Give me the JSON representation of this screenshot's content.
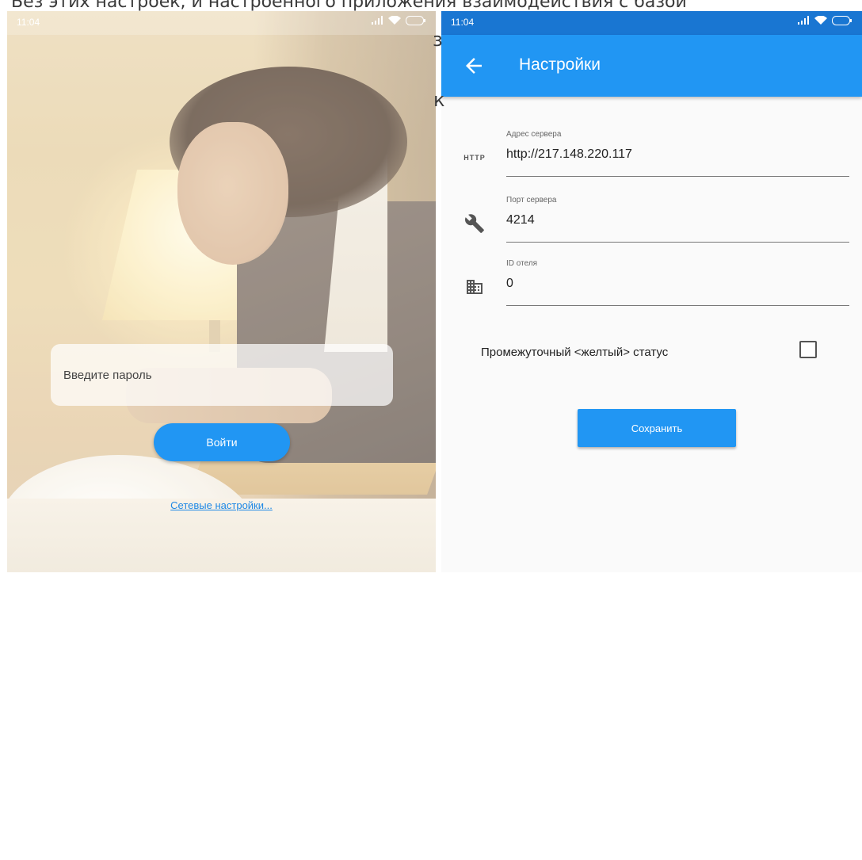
{
  "overlay": {
    "line1": "Без этих настроек, и настроенного приложения взаимодействия с базой",
    "line2": "з",
    "line3": "к"
  },
  "left_screen": {
    "status_time": "11:04",
    "password_placeholder": "Введите пароль",
    "login_label": "Войти",
    "network_settings_link": "Сетевые настройки..."
  },
  "right_screen": {
    "status_time": "11:04",
    "title": "Настройки",
    "fields": [
      {
        "label": "Адрес сервера",
        "value": "http://217.148.220.117",
        "icon": "http-icon",
        "icon_text": "HTTP"
      },
      {
        "label": "Порт сервера",
        "value": "4214",
        "icon": "wrench-icon"
      },
      {
        "label": "ID отеля",
        "value": "0",
        "icon": "building-icon"
      }
    ],
    "checkbox_label": "Промежуточный <желтый> статус",
    "checkbox_checked": false,
    "save_label": "Сохранить"
  },
  "colors": {
    "primary": "#2196f3",
    "primary_dark": "#1976d2",
    "link": "#1e88e5"
  }
}
